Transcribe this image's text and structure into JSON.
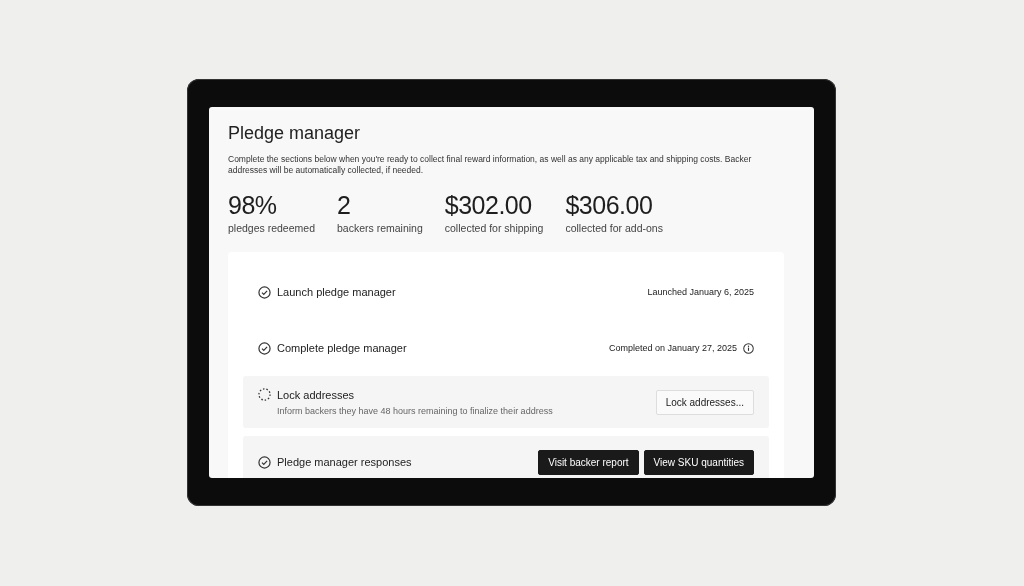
{
  "title": "Pledge manager",
  "description": "Complete the sections below when you're ready to collect final reward information, as well as any applicable tax and shipping costs. Backer addresses will be automatically collected, if needed.",
  "stats": [
    {
      "value": "98%",
      "label": "pledges redeemed"
    },
    {
      "value": "2",
      "label": "backers remaining"
    },
    {
      "value": "$302.00",
      "label": "collected for shipping"
    },
    {
      "value": "$306.00",
      "label": "collected for add-ons"
    }
  ],
  "steps": [
    {
      "kind": "plain",
      "title": "Launch pledge manager",
      "complete": true,
      "note": "Launched January 6, 2025",
      "info": false
    },
    {
      "kind": "plain",
      "title": "Complete pledge manager",
      "complete": true,
      "note": "Completed on January 27, 2025",
      "info": true
    },
    {
      "kind": "card",
      "title": "Lock addresses",
      "complete": false,
      "description": "Inform backers they have 48 hours remaining to finalize their address",
      "buttons": [
        {
          "label": "Lock addresses...",
          "primary": false
        }
      ]
    },
    {
      "kind": "card",
      "title": "Pledge manager responses",
      "complete": true,
      "buttons": [
        {
          "label": "Visit backer report",
          "primary": true
        },
        {
          "label": "View SKU quantities",
          "primary": true
        }
      ]
    }
  ]
}
